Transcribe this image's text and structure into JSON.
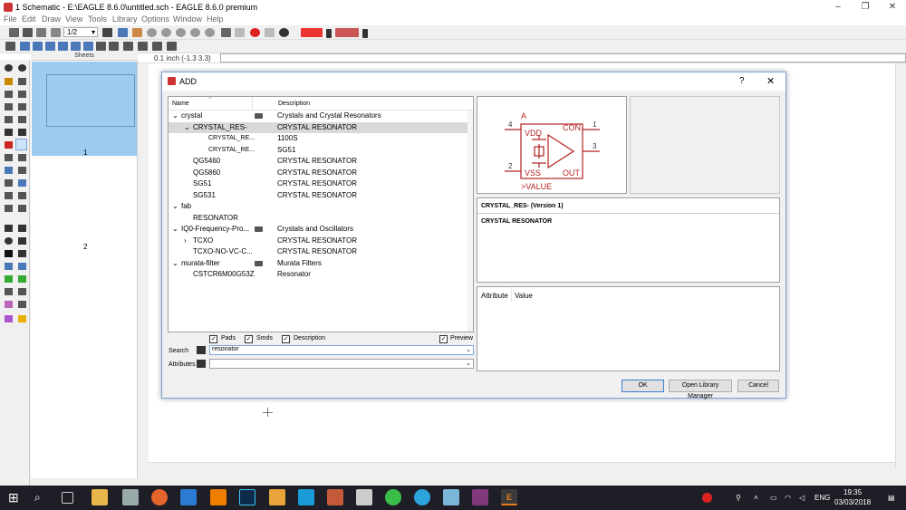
{
  "window": {
    "title": "1 Schematic - E:\\EAGLE 8.6.0\\untitled.sch - EAGLE 8.6.0 premium",
    "minimize": "–",
    "maximize": "❐",
    "close": "✕"
  },
  "menu": [
    "File",
    "Edit",
    "Draw",
    "View",
    "Tools",
    "Library",
    "Options",
    "Window",
    "Help"
  ],
  "toolbar": {
    "sheet_selector": "1/2",
    "coord_readout": "0.1 inch (-1.3 3.3)"
  },
  "sheets": {
    "header": "Sheets",
    "items": [
      "1",
      "2"
    ]
  },
  "dialog": {
    "title": "ADD",
    "help": "?",
    "close": "✕",
    "columns": {
      "name": "Name",
      "description": "Description"
    },
    "rows": [
      {
        "indent": 0,
        "toggle": "⌄",
        "name": "crystal",
        "lib_icon": true,
        "description": "Crystals and Crystal Resonators",
        "selected": false
      },
      {
        "indent": 1,
        "toggle": "⌄",
        "name": "CRYSTAL_RES-",
        "lib_icon": false,
        "description": "CRYSTAL RESONATOR",
        "selected": true
      },
      {
        "indent": 2,
        "toggle": "",
        "name": "CRYSTAL_RE...",
        "lib_icon": false,
        "description": "1100S",
        "selected": false
      },
      {
        "indent": 2,
        "toggle": "",
        "name": "CRYSTAL_RE...",
        "lib_icon": false,
        "description": "SG51",
        "selected": false
      },
      {
        "indent": 1,
        "toggle": "",
        "name": "QG5460",
        "lib_icon": false,
        "description": "CRYSTAL RESONATOR",
        "selected": false
      },
      {
        "indent": 1,
        "toggle": "",
        "name": "QG5860",
        "lib_icon": false,
        "description": "CRYSTAL RESONATOR",
        "selected": false
      },
      {
        "indent": 1,
        "toggle": "",
        "name": "SG51",
        "lib_icon": false,
        "description": "CRYSTAL RESONATOR",
        "selected": false
      },
      {
        "indent": 1,
        "toggle": "",
        "name": "SG531",
        "lib_icon": false,
        "description": "CRYSTAL RESONATOR",
        "selected": false
      },
      {
        "indent": 0,
        "toggle": "⌄",
        "name": "fab",
        "lib_icon": false,
        "description": "",
        "selected": false
      },
      {
        "indent": 1,
        "toggle": "",
        "name": "RESONATOR",
        "lib_icon": false,
        "description": "",
        "selected": false
      },
      {
        "indent": 0,
        "toggle": "⌄",
        "name": "IQ0-Frequency-Pro...",
        "lib_icon": true,
        "description": "Crystals and Oscillators",
        "selected": false
      },
      {
        "indent": 1,
        "toggle": "›",
        "name": "TCXO",
        "lib_icon": false,
        "description": "CRYSTAL RESONATOR",
        "selected": false
      },
      {
        "indent": 1,
        "toggle": "",
        "name": "TCXO-NO-VC-C...",
        "lib_icon": false,
        "description": "CRYSTAL RESONATOR",
        "selected": false
      },
      {
        "indent": 0,
        "toggle": "⌄",
        "name": "murata-filter",
        "lib_icon": true,
        "description": "Murata Filters",
        "selected": false
      },
      {
        "indent": 1,
        "toggle": "",
        "name": "CSTCR6M00G53Z",
        "lib_icon": false,
        "description": "Resonator",
        "selected": false
      }
    ],
    "checks": {
      "pads": "Pads",
      "smds": "Smds",
      "description": "Description",
      "preview": "Preview"
    },
    "search_label": "Search",
    "search_value": "resonator",
    "attributes_label": "Attributes",
    "attributes_value": "",
    "symbol": {
      "name_label": "A",
      "vdd": "VDD",
      "vss": "VSS",
      "con": "CON",
      "out": "OUT",
      "value": ">VALUE",
      "pin4": "4",
      "pin2": "2",
      "pin1": "1",
      "pin3": "3",
      "color": "#b22222"
    },
    "info_title": "CRYSTAL_RES- (Version 1)",
    "info_desc": "CRYSTAL RESONATOR",
    "attr_table": {
      "attribute": "Attribute",
      "value": "Value"
    },
    "buttons": {
      "ok": "OK",
      "open_lib_mgr": "Open Library Manager",
      "cancel": "Cancel"
    }
  },
  "taskbar": {
    "time": "19:35",
    "date": "03/03/2018",
    "lang": "ENG"
  }
}
